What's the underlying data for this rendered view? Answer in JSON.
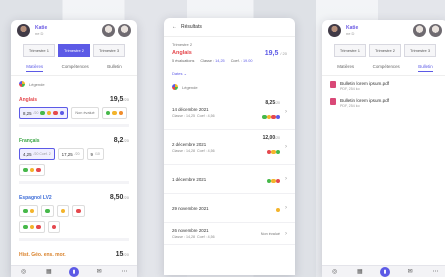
{
  "panel1": {
    "profile": {
      "name": "Katie",
      "class": "ne D"
    },
    "trimesters": [
      "Trimestre 1",
      "Trimestre 2",
      "Trimestre 3"
    ],
    "tabs": [
      "Matières",
      "Compétences",
      "Bulletin"
    ],
    "legend": "Légende",
    "subjects": [
      {
        "name": "Anglais",
        "color": "#e5484d",
        "avg": "19,5",
        "max": "/20",
        "chips": [
          {
            "v": "8,25",
            "s": "/20"
          },
          {
            "v": "Non évalué"
          }
        ]
      },
      {
        "name": "Français",
        "color": "#3aa645",
        "avg": "8,2",
        "max": "/20",
        "chips": [
          {
            "v": "4,25",
            "s": "/20 Coef. 2"
          },
          {
            "v": "17,25",
            "s": "/20"
          },
          {
            "v": "9",
            "s": "/10"
          }
        ]
      },
      {
        "name": "Espagnol LV2",
        "color": "#3f6ed8",
        "avg": "8,50",
        "max": "/20",
        "chips": []
      },
      {
        "name": "Hist. Géo. ens. mor.",
        "color": "#d9822b",
        "avg": "15",
        "max": "/20",
        "chips": []
      }
    ]
  },
  "panel2": {
    "back": "Résultats",
    "trimester": "Trimestre 2",
    "subject": "Anglais",
    "avg": "19,5",
    "max": "/ 20",
    "count": "5 évaluations",
    "class_avg_label": "Classe :",
    "class_avg": "14,25",
    "coef_label": "Coef. :",
    "coef": "19.00",
    "sort": "Dates",
    "evals": [
      {
        "date": "14 décembre 2021",
        "meta_cls": "Classe : 14,25",
        "meta_coef": "Coef : 4,56",
        "val": "8,25",
        "max": "/20"
      },
      {
        "date": "2 décembre 2021",
        "meta_cls": "Classe : 14,28",
        "meta_coef": "Coef : 4,56",
        "val": "12,00",
        "max": "/20"
      },
      {
        "date": "1 décembre 2021",
        "meta_cls": "",
        "meta_coef": "",
        "val": "",
        "max": ""
      },
      {
        "date": "29 novembre 2021",
        "meta_cls": "",
        "meta_coef": "",
        "val": "",
        "max": ""
      },
      {
        "date": "26 novembre 2021",
        "meta_cls": "Classe : 14,28",
        "meta_coef": "Coef : 4,56",
        "val": "Non évalué",
        "max": ""
      }
    ]
  },
  "panel3": {
    "profile": {
      "name": "Katie",
      "class": "ne D"
    },
    "trimesters": [
      "Trimestre 1",
      "Trimestre 2",
      "Trimestre 3"
    ],
    "tabs": [
      "Matières",
      "Compétences",
      "Bulletin"
    ],
    "bulletins": [
      {
        "title": "Bulletin lorem ipsum.pdf",
        "size": "PDF, 254 ko"
      },
      {
        "title": "Bulletin lorem ipsum.pdf",
        "size": "PDF, 254 ko"
      }
    ]
  },
  "nav_icons": [
    "home-icon",
    "calendar-icon",
    "chart-icon",
    "mail-icon",
    "more-icon"
  ]
}
